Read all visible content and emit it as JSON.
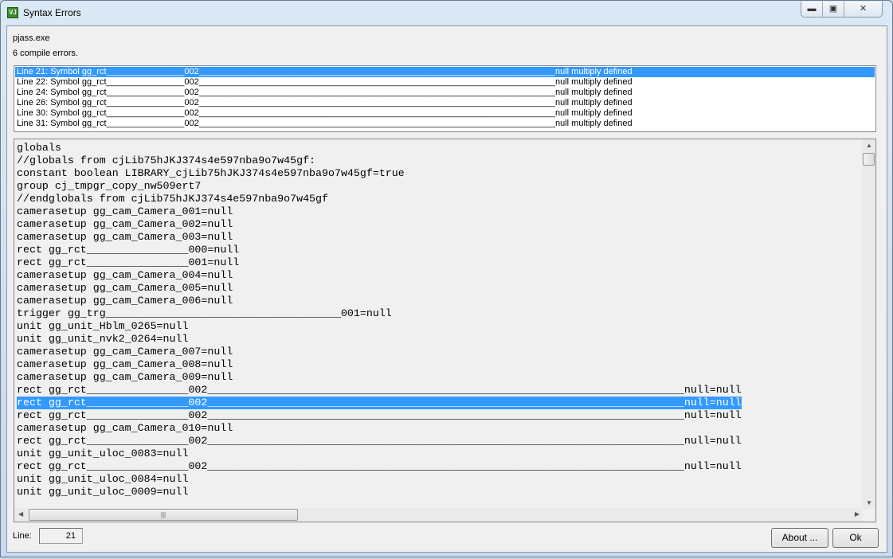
{
  "window": {
    "title": "Syntax Errors",
    "icon": "vjass-app-icon",
    "icon_text": "VJ"
  },
  "controls": {
    "minimize": "minimize-icon",
    "maximize": "maximize-icon",
    "close": "close-icon"
  },
  "header": {
    "program": "pjass.exe",
    "summary": "6 compile errors."
  },
  "errors": [
    {
      "loc": "Line 21:  Symbol gg_rct________________002___________________________________________________________________________",
      "msg": "null multiply defined",
      "selected": true
    },
    {
      "loc": "Line 22:  Symbol gg_rct________________002___________________________________________________________________________",
      "msg": "null multiply defined"
    },
    {
      "loc": "Line 24:  Symbol gg_rct________________002___________________________________________________________________________",
      "msg": "null multiply defined"
    },
    {
      "loc": "Line 26:  Symbol gg_rct________________002___________________________________________________________________________",
      "msg": "null multiply defined"
    },
    {
      "loc": "Line 30:  Symbol gg_rct________________002___________________________________________________________________________",
      "msg": "null multiply defined"
    },
    {
      "loc": "Line 31:  Symbol gg_rct________________002___________________________________________________________________________",
      "msg": "null multiply defined"
    }
  ],
  "code_lines": [
    "globals",
    "//globals from cjLib75hJKJ374s4e597nba9o7w45gf:",
    "constant boolean LIBRARY_cjLib75hJKJ374s4e597nba9o7w45gf=true",
    "group cj_tmpgr_copy_nw509ert7",
    "//endglobals from cjLib75hJKJ374s4e597nba9o7w45gf",
    "camerasetup gg_cam_Camera_001=null",
    "camerasetup gg_cam_Camera_002=null",
    "camerasetup gg_cam_Camera_003=null",
    "rect gg_rct________________000=null",
    "rect gg_rct________________001=null",
    "camerasetup gg_cam_Camera_004=null",
    "camerasetup gg_cam_Camera_005=null",
    "camerasetup gg_cam_Camera_006=null",
    "trigger gg_trg_____________________________________001=null",
    "unit gg_unit_Hblm_0265=null",
    "unit gg_unit_nvk2_0264=null",
    "camerasetup gg_cam_Camera_007=null",
    "camerasetup gg_cam_Camera_008=null",
    "camerasetup gg_cam_Camera_009=null",
    "rect gg_rct________________002___________________________________________________________________________null=null",
    "rect gg_rct________________002___________________________________________________________________________null=null",
    "rect gg_rct________________002___________________________________________________________________________null=null",
    "camerasetup gg_cam_Camera_010=null",
    "rect gg_rct________________002___________________________________________________________________________null=null",
    "unit gg_unit_uloc_0083=null",
    "rect gg_rct________________002___________________________________________________________________________null=null",
    "unit gg_unit_uloc_0084=null",
    "unit gg_unit_uloc_0009=null"
  ],
  "selected_code_line": 20,
  "footer": {
    "line_label": "Line:",
    "line_value": "21",
    "about": "About ...",
    "ok": "Ok"
  },
  "colors": {
    "selection": "#3399ff"
  }
}
